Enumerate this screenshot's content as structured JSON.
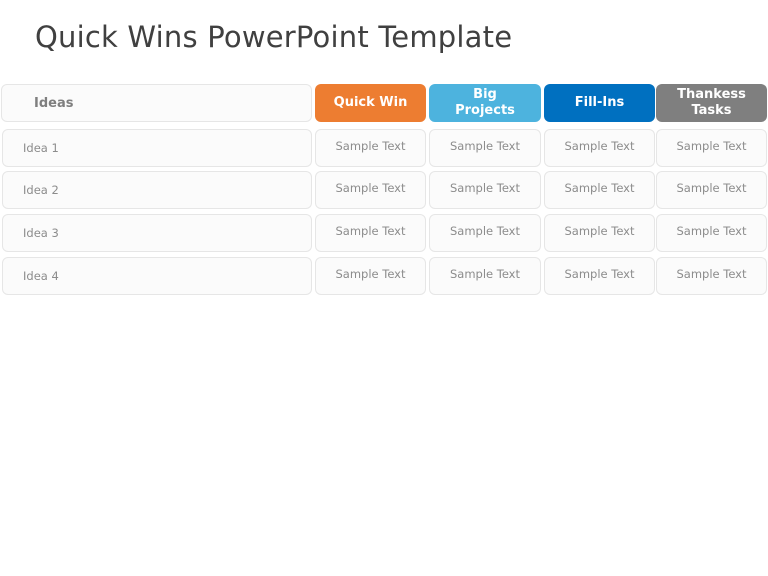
{
  "title": "Quick Wins PowerPoint Template",
  "table": {
    "headers": [
      {
        "label": "Ideas",
        "color": "#fbfbfb"
      },
      {
        "label": "Quick Win",
        "color": "#ed7d31"
      },
      {
        "label": "Big Projects",
        "color": "#4db3de"
      },
      {
        "label": "Fill-Ins",
        "color": "#0070c0"
      },
      {
        "label": "Thankess Tasks",
        "color": "#7f7f7f"
      }
    ],
    "rows": [
      {
        "idea": "Idea 1",
        "cells": [
          "Sample Text",
          "Sample Text",
          "Sample Text",
          "Sample Text"
        ]
      },
      {
        "idea": "Idea 2",
        "cells": [
          "Sample Text",
          "Sample Text",
          "Sample Text",
          "Sample Text"
        ]
      },
      {
        "idea": "Idea 3",
        "cells": [
          "Sample Text",
          "Sample Text",
          "Sample Text",
          "Sample Text"
        ]
      },
      {
        "idea": "Idea 4",
        "cells": [
          "Sample Text",
          "Sample Text",
          "Sample Text",
          "Sample Text"
        ]
      }
    ]
  }
}
